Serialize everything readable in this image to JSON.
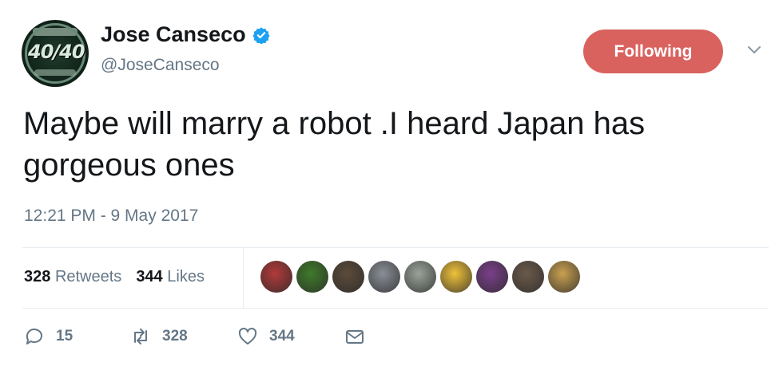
{
  "user": {
    "name": "Jose Canseco",
    "handle": "@JoseCanseco",
    "verified_icon": "verified-badge-icon",
    "avatar_text": "40/40"
  },
  "follow_button": {
    "label": "Following",
    "color": "#d9625f"
  },
  "tweet": {
    "text": "Maybe will marry a robot .I heard Japan has gorgeous ones",
    "timestamp": "12:21 PM - 9 May 2017"
  },
  "stats": {
    "retweets_count": "328",
    "retweets_label": "Retweets",
    "likes_count": "344",
    "likes_label": "Likes"
  },
  "likers": [
    {
      "color": "#b23a3a"
    },
    {
      "color": "#3f7a2a"
    },
    {
      "color": "#5c4b3a"
    },
    {
      "color": "#8a8f97"
    },
    {
      "color": "#9aa39a"
    },
    {
      "color": "#f0c23a"
    },
    {
      "color": "#7a3f8a"
    },
    {
      "color": "#6b5a4a"
    },
    {
      "color": "#c9a050"
    }
  ],
  "actions": {
    "reply_count": "15",
    "retweet_count": "328",
    "like_count": "344"
  },
  "colors": {
    "text_secondary": "#657786",
    "divider": "#e6ecf0",
    "verified": "#1da1f2"
  }
}
